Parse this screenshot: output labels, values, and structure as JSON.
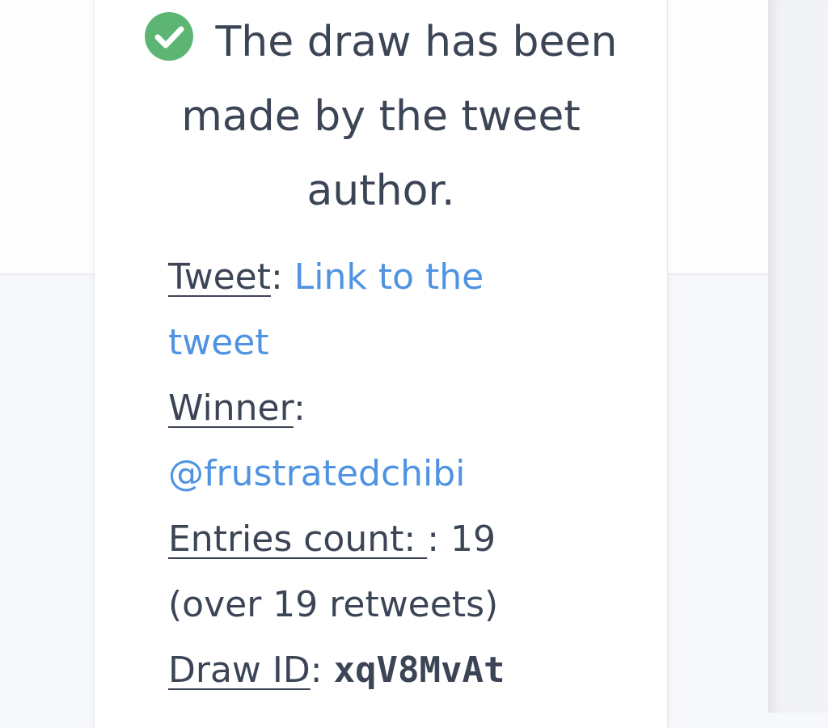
{
  "status": {
    "text": "The draw has been made by the tweet author.",
    "icon": "check-circle-icon",
    "icon_color": "#5cb572"
  },
  "details": {
    "tweet_label": "Tweet",
    "tweet_link": "Link to the tweet",
    "winner_label": "Winner",
    "winner_handle": "@frustratedchibi",
    "entries_label": "Entries count: ",
    "entries_value": "19",
    "entries_note": "(over 19 retweets)",
    "draw_id_label": "Draw ID",
    "draw_id": "xqV8MvAt"
  },
  "colors": {
    "text": "#3c4556",
    "link": "#4f93e2"
  }
}
